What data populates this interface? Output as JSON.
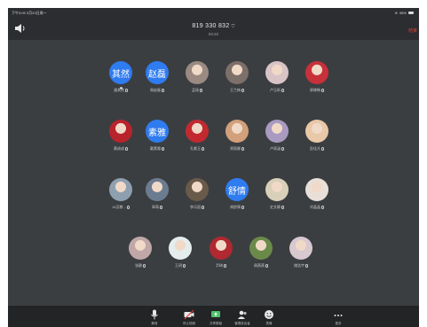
{
  "status_bar": {
    "time": "下午3:09  3月23日周一",
    "battery": "98%"
  },
  "header": {
    "meeting_id": "819 330 832",
    "timer": "04:22",
    "end_label": "结束"
  },
  "participants": [
    {
      "kind": "text",
      "initials": "其然",
      "name": "潘其然",
      "color": "#2f7bf0",
      "speaking": true
    },
    {
      "kind": "text",
      "initials": "赵磊",
      "name": "周赵磊",
      "color": "#2f7bf0"
    },
    {
      "kind": "photo",
      "name": "孟瑶",
      "photo": "portrait-1"
    },
    {
      "kind": "photo",
      "name": "王兰梅",
      "photo": "portrait-2"
    },
    {
      "kind": "photo",
      "name": "卢玉昕",
      "photo": "portrait-3"
    },
    {
      "kind": "photo",
      "name": "郭晓畅",
      "photo": "portrait-4"
    },
    {
      "kind": "photo",
      "name": "黄成成",
      "photo": "portrait-5"
    },
    {
      "kind": "text",
      "initials": "素雅",
      "name": "戴素雅",
      "color": "#2f7bf0"
    },
    {
      "kind": "photo",
      "name": "孔紫玉",
      "photo": "portrait-6"
    },
    {
      "kind": "photo",
      "name": "郑丽娜",
      "photo": "portrait-7"
    },
    {
      "kind": "photo",
      "name": "卢雨涵",
      "photo": "portrait-8"
    },
    {
      "kind": "photo",
      "name": "彭佳凡",
      "photo": "portrait-9"
    },
    {
      "kind": "photo",
      "name": "16汉教...",
      "photo": "landscape-1"
    },
    {
      "kind": "photo",
      "name": "翠萌",
      "photo": "landscape-2"
    },
    {
      "kind": "photo",
      "name": "李乐园",
      "photo": "portrait-10"
    },
    {
      "kind": "text",
      "initials": "舒情",
      "name": "胡舒情",
      "color": "#2f7bf0"
    },
    {
      "kind": "photo",
      "name": "史文静",
      "photo": "portrait-11"
    },
    {
      "kind": "photo",
      "name": "刘晶晶",
      "photo": "portrait-12"
    },
    {
      "kind": "photo",
      "name": "张静",
      "photo": "portrait-13"
    },
    {
      "kind": "photo",
      "name": "王玥",
      "photo": "portrait-14"
    },
    {
      "kind": "photo",
      "name": "尹琦",
      "photo": "portrait-15"
    },
    {
      "kind": "photo",
      "name": "周燕燕",
      "photo": "landscape-3"
    },
    {
      "kind": "photo",
      "name": "储浩宇",
      "photo": "portrait-16"
    }
  ],
  "toolbar": {
    "mute": "静音",
    "stop_video": "停止视频",
    "share": "共享屏幕",
    "participants": "管理参会者",
    "reactions": "表情",
    "more": "更多"
  }
}
